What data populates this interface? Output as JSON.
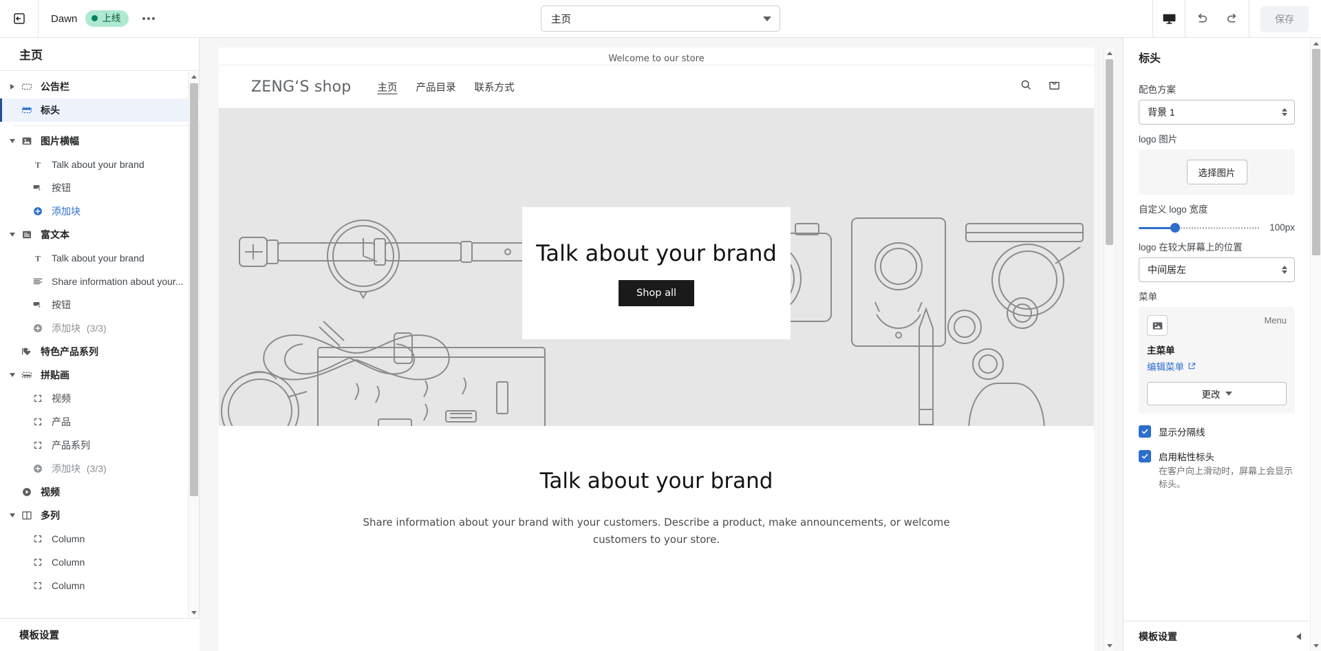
{
  "topbar": {
    "exit_icon": "exit-left-icon",
    "theme_name": "Dawn",
    "status_badge": "上线",
    "more_icon": "more-dots-icon",
    "page_selector": {
      "value": "主页",
      "caret": "chevron-down-icon"
    },
    "devices_icon": "desktop-icon",
    "undo_icon": "undo-icon",
    "redo_icon": "redo-icon",
    "save_label": "保存"
  },
  "sidebar": {
    "title": "主页",
    "footer_label": "模板设置",
    "items": [
      {
        "label": "公告栏",
        "icon": "announcement-bar-icon",
        "level": "section",
        "arrow": "right",
        "selected": false
      },
      {
        "label": "标头",
        "icon": "header-section-icon",
        "level": "section",
        "arrow": "none",
        "selected": true
      },
      {
        "label": "图片横幅",
        "icon": "image-banner-icon",
        "level": "section",
        "arrow": "down",
        "selected": false
      },
      {
        "label": "Talk about your brand",
        "icon": "text-block-icon",
        "level": "block"
      },
      {
        "label": "按钮",
        "icon": "button-block-icon",
        "level": "block"
      },
      {
        "label": "添加块",
        "icon": "plus-circle-icon",
        "level": "add",
        "state": "enabled"
      },
      {
        "label": "富文本",
        "icon": "rich-text-icon",
        "level": "section",
        "arrow": "down",
        "selected": false
      },
      {
        "label": "Talk about your brand",
        "icon": "text-block-icon",
        "level": "block"
      },
      {
        "label": "Share information about your...",
        "icon": "paragraph-icon",
        "level": "block"
      },
      {
        "label": "按钮",
        "icon": "button-block-icon",
        "level": "block"
      },
      {
        "label": "添加块",
        "icon": "plus-circle-icon",
        "level": "add",
        "count": "(3/3)",
        "state": "disabled"
      },
      {
        "label": "特色产品系列",
        "icon": "collection-tag-icon",
        "level": "section",
        "arrow": "none",
        "selected": false
      },
      {
        "label": "拼贴画",
        "icon": "collage-icon",
        "level": "section",
        "arrow": "down",
        "selected": false
      },
      {
        "label": "视频",
        "icon": "block-brackets-icon",
        "level": "block"
      },
      {
        "label": "产品",
        "icon": "block-brackets-icon",
        "level": "block"
      },
      {
        "label": "产品系列",
        "icon": "block-brackets-icon",
        "level": "block"
      },
      {
        "label": "添加块",
        "icon": "plus-circle-icon",
        "level": "add",
        "count": "(3/3)",
        "state": "disabled"
      },
      {
        "label": "视频",
        "icon": "video-play-icon",
        "level": "section",
        "arrow": "none",
        "selected": false
      },
      {
        "label": "多列",
        "icon": "multicolumn-icon",
        "level": "section",
        "arrow": "down",
        "selected": false
      },
      {
        "label": "Column",
        "icon": "block-brackets-icon",
        "level": "block"
      },
      {
        "label": "Column",
        "icon": "block-brackets-icon",
        "level": "block"
      },
      {
        "label": "Column",
        "icon": "block-brackets-icon",
        "level": "block"
      }
    ]
  },
  "preview": {
    "announcement": "Welcome to our store",
    "store_name": "ZENG‘S shop",
    "nav": [
      {
        "label": "主页",
        "active": true
      },
      {
        "label": "产品目录",
        "active": false
      },
      {
        "label": "联系方式",
        "active": false
      }
    ],
    "search_icon": "search-icon",
    "cart_icon": "cart-icon",
    "hero": {
      "title": "Talk about your brand",
      "button": "Shop all"
    },
    "rich_text": {
      "title": "Talk about your brand",
      "body": "Share information about your brand with your customers. Describe a product, make announcements, or welcome customers to your store."
    }
  },
  "right_panel": {
    "title": "标头",
    "color_scheme": {
      "label": "配色方案",
      "value": "背景 1"
    },
    "logo_image": {
      "label": "logo 图片",
      "button": "选择图片"
    },
    "logo_width": {
      "label": "自定义 logo 宽度",
      "value": "100px",
      "percent": 30
    },
    "logo_position": {
      "label": "logo 在较大屏幕上的位置",
      "value": "中间居左"
    },
    "menu": {
      "label": "菜单",
      "tag": "Menu",
      "name": "主菜单",
      "edit_link": "编辑菜单",
      "change_button": "更改",
      "thumb_icon": "image-placeholder-icon",
      "external_icon": "external-link-icon"
    },
    "checkboxes": [
      {
        "label": "显示分隔线",
        "checked": true,
        "help": ""
      },
      {
        "label": "启用粘性标头",
        "checked": true,
        "help": "在客户向上滑动时，屏幕上会显示标头。"
      }
    ],
    "footer_label": "模板设置"
  },
  "colors": {
    "accent_blue": "#2c6ecb",
    "selected_bg": "#eef3fb",
    "badge_bg": "#aee9d1",
    "badge_text": "#0c5132",
    "hero_bg": "#e6e6e6"
  }
}
